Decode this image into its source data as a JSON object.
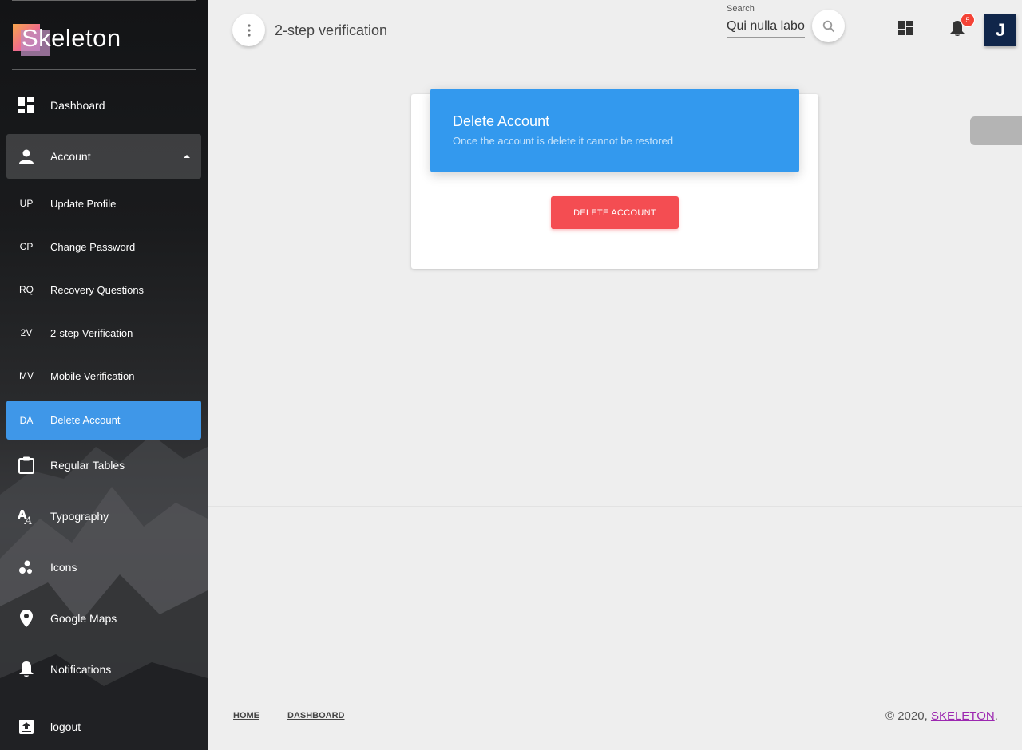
{
  "app": {
    "logo_text": "Skeleton"
  },
  "sidebar": {
    "items": [
      {
        "label": "Dashboard",
        "icon": "dashboard-icon"
      },
      {
        "label": "Account",
        "icon": "person-icon"
      },
      {
        "label": "Regular Tables",
        "icon": "clipboard-icon"
      },
      {
        "label": "Typography",
        "icon": "typography-icon"
      },
      {
        "label": "Icons",
        "icon": "bubbles-icon"
      },
      {
        "label": "Google Maps",
        "icon": "location-pin-icon"
      },
      {
        "label": "Notifications",
        "icon": "bell-icon"
      },
      {
        "label": "logout",
        "icon": "logout-icon"
      }
    ],
    "account_sub": [
      {
        "abbr": "UP",
        "label": "Update Profile"
      },
      {
        "abbr": "CP",
        "label": "Change Password"
      },
      {
        "abbr": "RQ",
        "label": "Recovery Questions"
      },
      {
        "abbr": "2V",
        "label": "2-step Verification"
      },
      {
        "abbr": "MV",
        "label": "Mobile Verification"
      },
      {
        "abbr": "DA",
        "label": "Delete Account"
      }
    ]
  },
  "header": {
    "title": "2-step verification",
    "search_label": "Search",
    "search_value": "Qui nulla laboris",
    "notifications_count": "5",
    "avatar_letter": "J"
  },
  "card": {
    "title": "Delete Account",
    "subtitle": "Once the account is delete it cannot be restored",
    "button_label": "DELETE ACCOUNT"
  },
  "footer": {
    "links": [
      "HOME",
      "DASHBOARD"
    ],
    "copyright_prefix": "© 2020, ",
    "brand": "SKELETON",
    "suffix": "."
  },
  "colors": {
    "accent": "#3f97e8",
    "card_header": "#3399ee",
    "danger": "#f44d52",
    "badge": "#f44336",
    "avatar_bg": "#10264a"
  }
}
